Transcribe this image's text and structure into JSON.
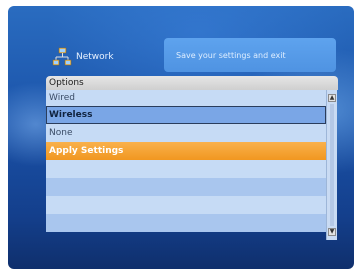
{
  "header": {
    "icon": "network-icon",
    "title": "Network"
  },
  "help": {
    "text": "Save your settings and exit"
  },
  "options": {
    "header": "Options",
    "items": [
      {
        "label": "Wired",
        "state": "normal"
      },
      {
        "label": "Wireless",
        "state": "selected"
      },
      {
        "label": "None",
        "state": "normal"
      },
      {
        "label": "Apply Settings",
        "state": "focused"
      },
      {
        "label": "",
        "state": "empty"
      },
      {
        "label": "",
        "state": "empty"
      },
      {
        "label": "",
        "state": "empty"
      },
      {
        "label": "",
        "state": "empty"
      }
    ]
  },
  "colors": {
    "background": "#1a52a8",
    "help_box": "#5ea3ee",
    "selected_row": "#7aa6e6",
    "focus_row": "#f19720",
    "row_light": "#c6dbf5",
    "row_dark": "#a9c6ee"
  }
}
